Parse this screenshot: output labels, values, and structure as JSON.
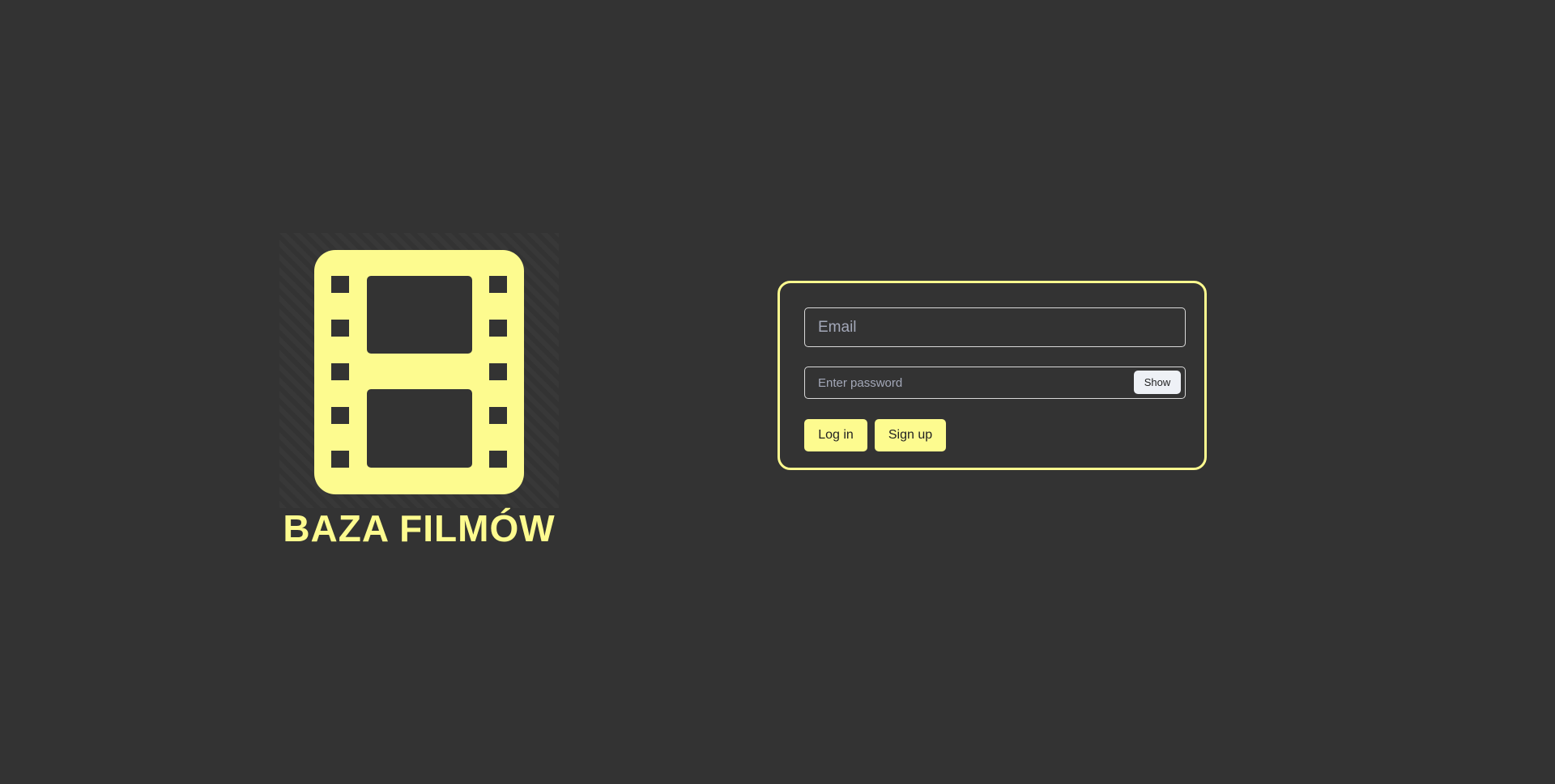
{
  "logo": {
    "title": "BAZA FILMÓW",
    "icon": "film-strip-icon",
    "color": "#fdfb8f"
  },
  "form": {
    "email_placeholder": "Email",
    "email_value": "",
    "password_placeholder": "Enter password",
    "password_value": "",
    "show_label": "Show",
    "login_label": "Log in",
    "signup_label": "Sign up"
  },
  "colors": {
    "background": "#333333",
    "accent": "#fdfb8f"
  }
}
